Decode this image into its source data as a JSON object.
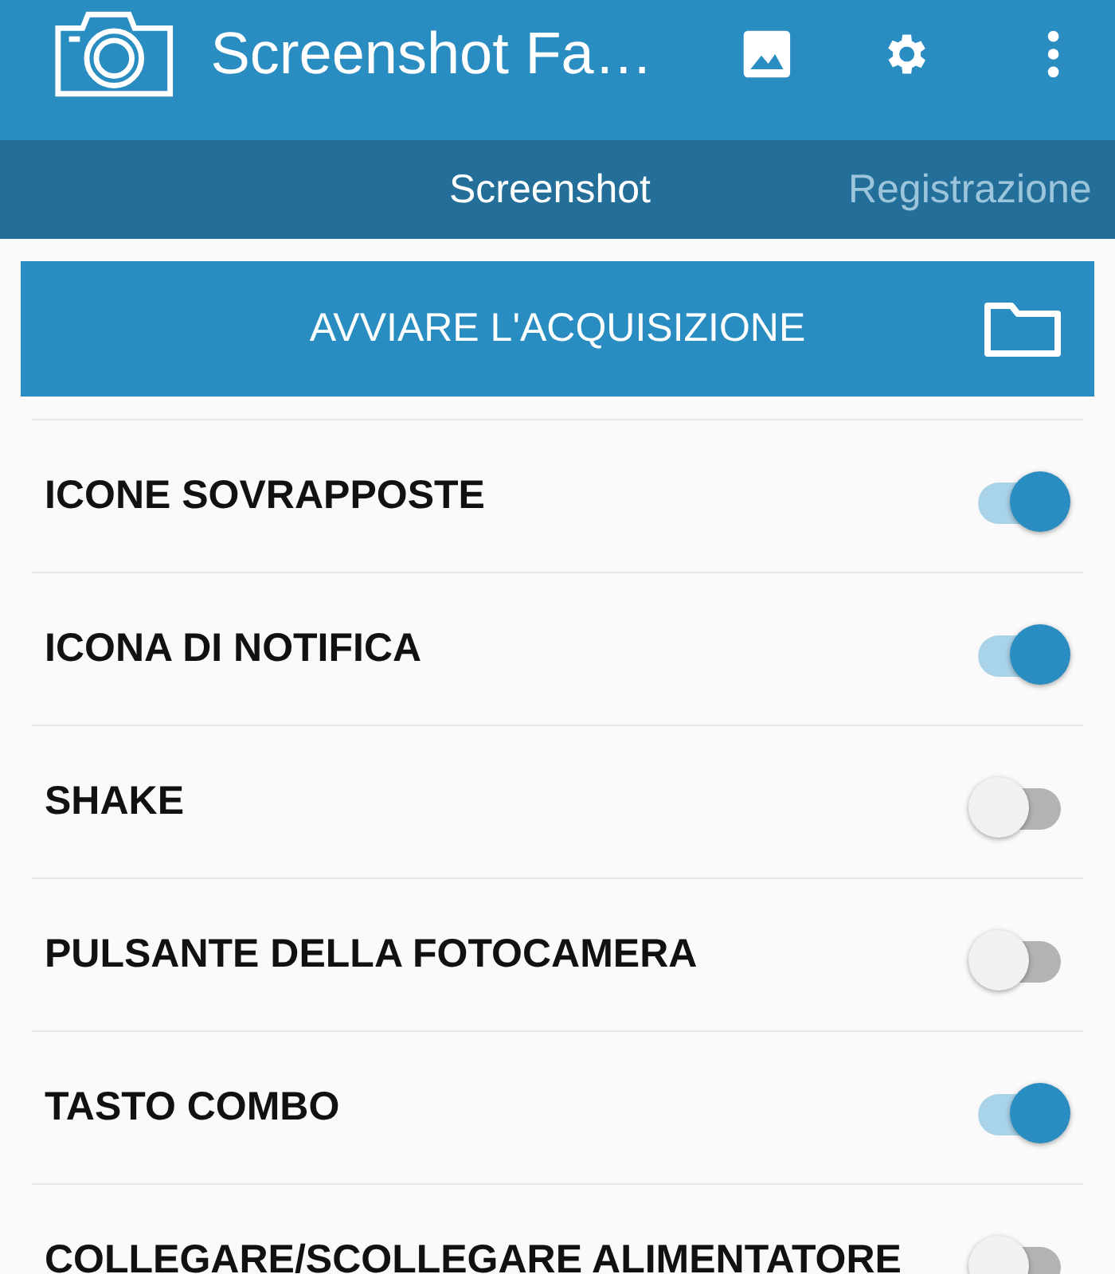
{
  "app_bar": {
    "title": "Screenshot Fa…"
  },
  "tabs": [
    {
      "label": "Screenshot",
      "selected": true
    },
    {
      "label": "Registrazione",
      "selected": false
    }
  ],
  "capture_button": {
    "label": "AVVIARE L'ACQUISIZIONE"
  },
  "settings": [
    {
      "label": "ICONE SOVRAPPOSTE",
      "on": true
    },
    {
      "label": "ICONA DI NOTIFICA",
      "on": true
    },
    {
      "label": "SHAKE",
      "on": false
    },
    {
      "label": "PULSANTE DELLA FOTOCAMERA",
      "on": false
    },
    {
      "label": "TASTO COMBO",
      "on": true
    },
    {
      "label": "COLLEGARE/SCOLLEGARE ALIMENTATORE",
      "on": false
    }
  ]
}
